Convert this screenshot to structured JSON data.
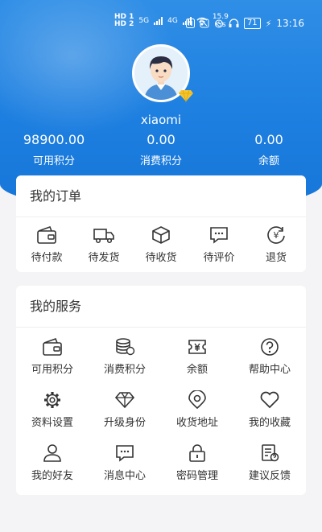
{
  "status_bar": {
    "hd1": "HD 1",
    "hd2": "HD 2",
    "net1": "5G",
    "net2": "4G",
    "speed_value": "15.9",
    "speed_unit": "K/s",
    "battery": "71",
    "time": "13:16"
  },
  "profile": {
    "username": "xiaomi"
  },
  "stats": [
    {
      "value": "98900.00",
      "label": "可用积分"
    },
    {
      "value": "0.00",
      "label": "消费积分"
    },
    {
      "value": "0.00",
      "label": "余额"
    }
  ],
  "orders": {
    "title": "我的订单",
    "items": [
      {
        "label": "待付款",
        "icon": "wallet-icon"
      },
      {
        "label": "待发货",
        "icon": "truck-icon"
      },
      {
        "label": "待收货",
        "icon": "package-icon"
      },
      {
        "label": "待评价",
        "icon": "comment-icon"
      },
      {
        "label": "退货",
        "icon": "refund-icon"
      }
    ]
  },
  "services": {
    "title": "我的服务",
    "items": [
      {
        "label": "可用积分",
        "icon": "wallet-icon"
      },
      {
        "label": "消费积分",
        "icon": "coins-icon"
      },
      {
        "label": "余额",
        "icon": "yuan-ticket-icon"
      },
      {
        "label": "帮助中心",
        "icon": "help-icon"
      },
      {
        "label": "资料设置",
        "icon": "gear-icon"
      },
      {
        "label": "升级身份",
        "icon": "diamond-icon"
      },
      {
        "label": "收货地址",
        "icon": "location-icon"
      },
      {
        "label": "我的收藏",
        "icon": "heart-icon"
      },
      {
        "label": "我的好友",
        "icon": "user-icon"
      },
      {
        "label": "消息中心",
        "icon": "message-icon"
      },
      {
        "label": "密码管理",
        "icon": "lock-icon"
      },
      {
        "label": "建议反馈",
        "icon": "feedback-icon"
      }
    ]
  }
}
